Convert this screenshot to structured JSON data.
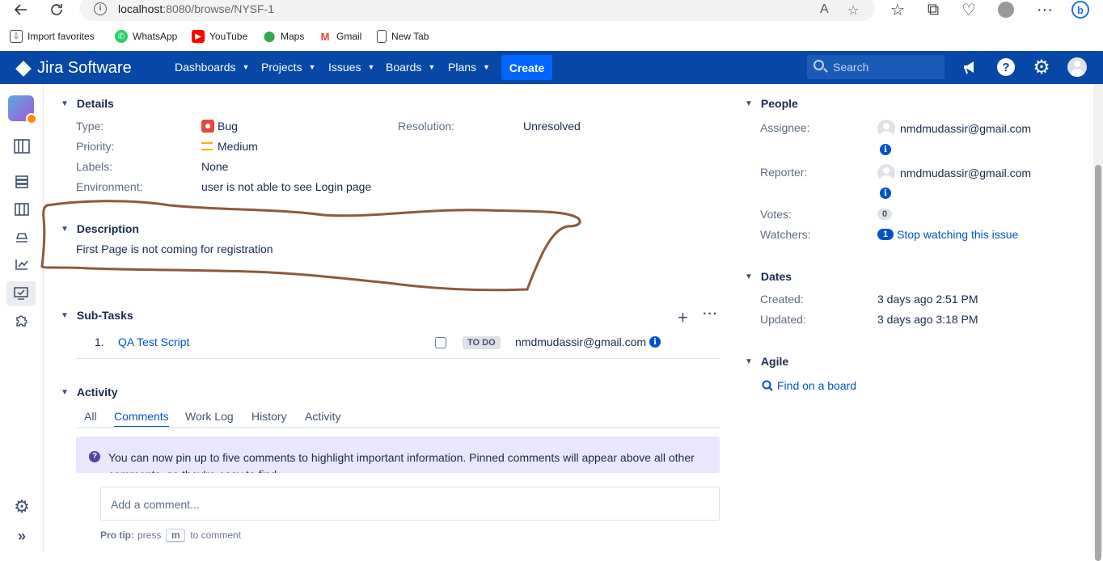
{
  "browser": {
    "url_host": "localhost",
    "url_path": ":8080/browse/NYSF-1",
    "bookmarks": [
      {
        "label": "Import favorites",
        "icon": "import-icon"
      },
      {
        "label": "WhatsApp",
        "icon": "whatsapp-icon",
        "color": "#25d366"
      },
      {
        "label": "YouTube",
        "icon": "youtube-icon",
        "color": "#ff0000"
      },
      {
        "label": "Maps",
        "icon": "maps-icon",
        "color": "#34a853"
      },
      {
        "label": "Gmail",
        "icon": "gmail-icon",
        "color": "#ea4335"
      },
      {
        "label": "New Tab",
        "icon": "page-icon"
      }
    ]
  },
  "nav": {
    "brand": "Jira Software",
    "items": [
      "Dashboards",
      "Projects",
      "Issues",
      "Boards",
      "Plans"
    ],
    "create": "Create",
    "search_placeholder": "Search",
    "brand_color": "#0747a6"
  },
  "details": {
    "title": "Details",
    "type_label": "Type:",
    "type_value": "Bug",
    "priority_label": "Priority:",
    "priority_value": "Medium",
    "labels_label": "Labels:",
    "labels_value": "None",
    "environment_label": "Environment:",
    "environment_value": "user is not able to see Login page",
    "resolution_label": "Resolution:",
    "resolution_value": "Unresolved"
  },
  "description": {
    "title": "Description",
    "text": "First Page is not coming for registration"
  },
  "subtasks": {
    "title": "Sub-Tasks",
    "items": [
      {
        "num": "1.",
        "name": "QA Test Script",
        "status": "TO DO",
        "assignee": "nmdmudassir@gmail.com"
      }
    ]
  },
  "activity": {
    "title": "Activity",
    "tabs": [
      "All",
      "Comments",
      "Work Log",
      "History",
      "Activity"
    ],
    "active_tab": "Comments",
    "tip": "You can now pin up to five comments to highlight important information. Pinned comments will appear above all other comments, so they're easy to find.",
    "comment_placeholder": "Add a comment...",
    "protip_label": "Pro tip:",
    "protip_press": "press",
    "protip_key": "m",
    "protip_suffix": "to comment"
  },
  "people": {
    "title": "People",
    "assignee_label": "Assignee:",
    "assignee": "nmdmudassir@gmail.com",
    "reporter_label": "Reporter:",
    "reporter": "nmdmudassir@gmail.com",
    "votes_label": "Votes:",
    "votes": "0",
    "watchers_label": "Watchers:",
    "watchers_count": "1",
    "watch_link": "Stop watching this issue"
  },
  "dates": {
    "title": "Dates",
    "created_label": "Created:",
    "created": "3 days ago 2:51 PM",
    "updated_label": "Updated:",
    "updated": "3 days ago 3:18 PM"
  },
  "agile": {
    "title": "Agile",
    "link": "Find on a board"
  }
}
